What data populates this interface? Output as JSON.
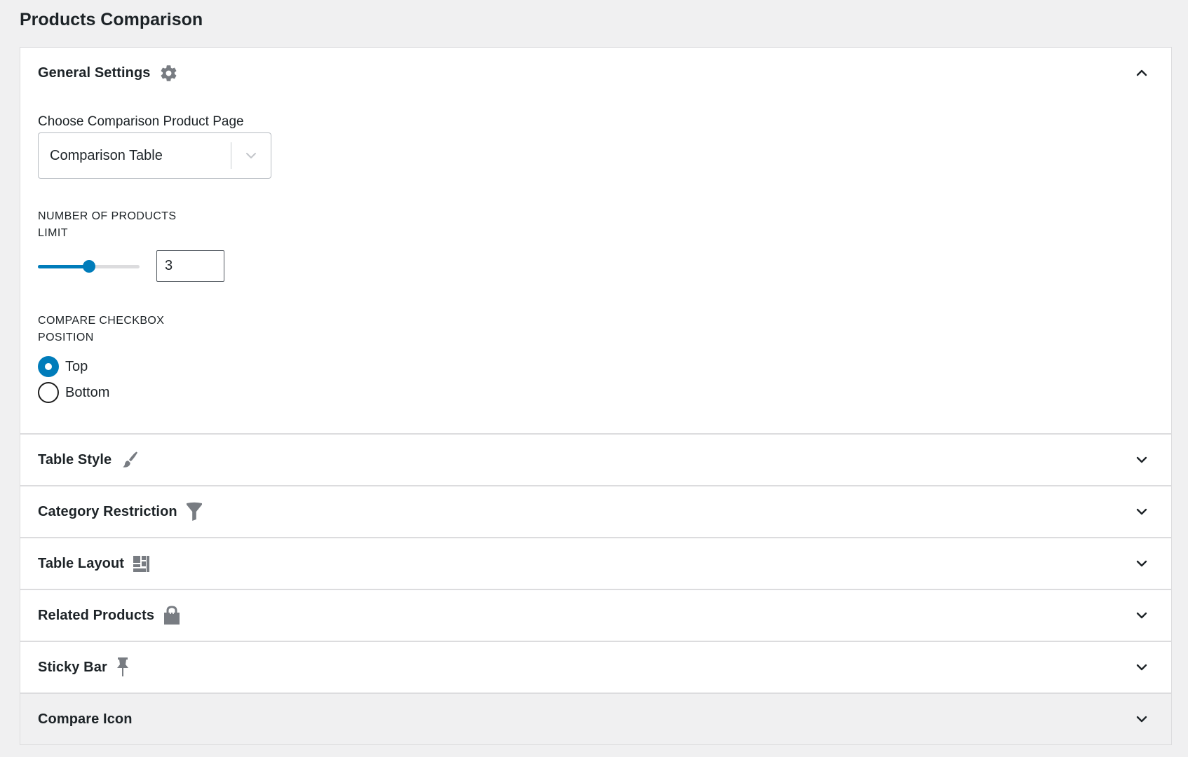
{
  "page": {
    "title": "Products Comparison"
  },
  "general": {
    "title": "General Settings",
    "icon": "gear-icon",
    "expanded": true,
    "comparison_page": {
      "label": "Choose Comparison Product Page",
      "value": "Comparison Table"
    },
    "products_limit": {
      "label": "NUMBER OF PRODUCTS LIMIT",
      "value": "3",
      "slider_fill_percent": 50
    },
    "checkbox_position": {
      "label": "COMPARE CHECKBOX POSITION",
      "options": [
        {
          "label": "Top",
          "checked": true
        },
        {
          "label": "Bottom",
          "checked": false
        }
      ]
    }
  },
  "sections": [
    {
      "title": "Table Style",
      "icon": "paintbrush-icon"
    },
    {
      "title": "Category Restriction",
      "icon": "filter-icon"
    },
    {
      "title": "Table Layout",
      "icon": "layout-icon"
    },
    {
      "title": "Related Products",
      "icon": "shopping-bag-icon"
    },
    {
      "title": "Sticky Bar",
      "icon": "pin-icon"
    },
    {
      "title": "Compare Icon",
      "icon": null
    }
  ],
  "colors": {
    "accent": "#007cba",
    "background": "#f0f0f1",
    "panel": "#ffffff",
    "border": "#dcdcde",
    "icon": "#787c82"
  }
}
